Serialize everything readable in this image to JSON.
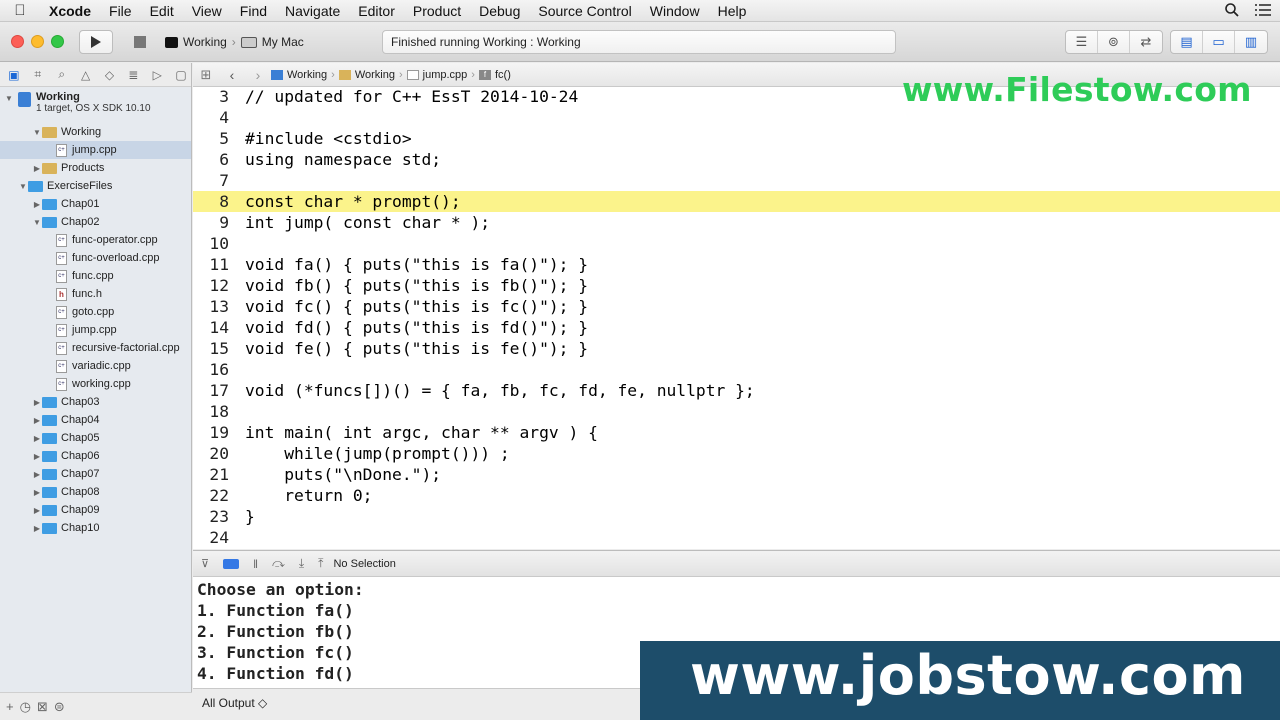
{
  "menubar": {
    "apple_icon": "",
    "app": "Xcode",
    "items": [
      "File",
      "Edit",
      "View",
      "Find",
      "Navigate",
      "Editor",
      "Product",
      "Debug",
      "Source Control",
      "Window",
      "Help"
    ]
  },
  "toolbar": {
    "scheme_name": "Working",
    "destination": "My Mac",
    "activity_status": "Finished running Working : Working"
  },
  "navigator": {
    "project": {
      "name": "Working",
      "subtitle": "1 target, OS X SDK 10.10"
    },
    "items": [
      {
        "label": "Working",
        "kind": "folder-gold",
        "indent": 1,
        "expanded": true
      },
      {
        "label": "jump.cpp",
        "kind": "file",
        "indent": 2,
        "selected": true
      },
      {
        "label": "Products",
        "kind": "folder-gold",
        "indent": 1,
        "expanded": false
      },
      {
        "label": "ExerciseFiles",
        "kind": "folder-blue",
        "indent": 0,
        "expanded": true
      },
      {
        "label": "Chap01",
        "kind": "folder-blue",
        "indent": 1,
        "expanded": false
      },
      {
        "label": "Chap02",
        "kind": "folder-blue",
        "indent": 1,
        "expanded": true
      },
      {
        "label": "func-operator.cpp",
        "kind": "file",
        "indent": 2
      },
      {
        "label": "func-overload.cpp",
        "kind": "file",
        "indent": 2
      },
      {
        "label": "func.cpp",
        "kind": "file",
        "indent": 2
      },
      {
        "label": "func.h",
        "kind": "header",
        "indent": 2
      },
      {
        "label": "goto.cpp",
        "kind": "file",
        "indent": 2
      },
      {
        "label": "jump.cpp",
        "kind": "file",
        "indent": 2
      },
      {
        "label": "recursive-factorial.cpp",
        "kind": "file",
        "indent": 2
      },
      {
        "label": "variadic.cpp",
        "kind": "file",
        "indent": 2
      },
      {
        "label": "working.cpp",
        "kind": "file",
        "indent": 2
      },
      {
        "label": "Chap03",
        "kind": "folder-blue",
        "indent": 1,
        "expanded": false
      },
      {
        "label": "Chap04",
        "kind": "folder-blue",
        "indent": 1,
        "expanded": false
      },
      {
        "label": "Chap05",
        "kind": "folder-blue",
        "indent": 1,
        "expanded": false
      },
      {
        "label": "Chap06",
        "kind": "folder-blue",
        "indent": 1,
        "expanded": false
      },
      {
        "label": "Chap07",
        "kind": "folder-blue",
        "indent": 1,
        "expanded": false
      },
      {
        "label": "Chap08",
        "kind": "folder-blue",
        "indent": 1,
        "expanded": false
      },
      {
        "label": "Chap09",
        "kind": "folder-blue",
        "indent": 1,
        "expanded": false
      },
      {
        "label": "Chap10",
        "kind": "folder-blue",
        "indent": 1,
        "expanded": false
      }
    ]
  },
  "jumpbar": {
    "crumbs": [
      "Working",
      "Working",
      "jump.cpp",
      "fc()"
    ]
  },
  "editor": {
    "highlighted_line": 8,
    "lines": [
      {
        "n": "3",
        "text": "// updated for C++ EssT 2014-10-24"
      },
      {
        "n": "4",
        "text": ""
      },
      {
        "n": "5",
        "text": "#include <cstdio>"
      },
      {
        "n": "6",
        "text": "using namespace std;"
      },
      {
        "n": "7",
        "text": ""
      },
      {
        "n": "8",
        "text": "const char * prompt();"
      },
      {
        "n": "9",
        "text": "int jump( const char * );"
      },
      {
        "n": "10",
        "text": ""
      },
      {
        "n": "11",
        "text": "void fa() { puts(\"this is fa()\"); }"
      },
      {
        "n": "12",
        "text": "void fb() { puts(\"this is fb()\"); }"
      },
      {
        "n": "13",
        "text": "void fc() { puts(\"this is fc()\"); }"
      },
      {
        "n": "14",
        "text": "void fd() { puts(\"this is fd()\"); }"
      },
      {
        "n": "15",
        "text": "void fe() { puts(\"this is fe()\"); }"
      },
      {
        "n": "16",
        "text": ""
      },
      {
        "n": "17",
        "text": "void (*funcs[])() = { fa, fb, fc, fd, fe, nullptr };"
      },
      {
        "n": "18",
        "text": ""
      },
      {
        "n": "19",
        "text": "int main( int argc, char ** argv ) {"
      },
      {
        "n": "20",
        "text": "    while(jump(prompt())) ;"
      },
      {
        "n": "21",
        "text": "    puts(\"\\nDone.\");"
      },
      {
        "n": "22",
        "text": "    return 0;"
      },
      {
        "n": "23",
        "text": "}"
      },
      {
        "n": "24",
        "text": ""
      }
    ]
  },
  "debugbar": {
    "selection": "No Selection"
  },
  "console": {
    "lines": [
      "Choose an option:",
      "1. Function fa()",
      "2. Function fb()",
      "3. Function fc()",
      "4. Function fd()"
    ],
    "filter": "All Output ◇"
  },
  "watermarks": {
    "top": "www.Filestow.com",
    "bottom": "www.jobstow.com"
  },
  "colors": {
    "highlight": "#fbf38b",
    "accent": "#1a67d6",
    "watermark_green": "#2ecc58",
    "watermark_bar": "#1d4d6a"
  }
}
